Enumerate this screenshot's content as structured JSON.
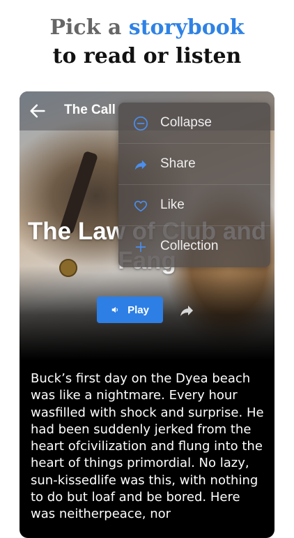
{
  "promo": {
    "line1_prefix": "Pick a",
    "line1_accent": "storybook",
    "line2": "to read or listen"
  },
  "colors": {
    "accent": "#2e82e5",
    "play_button": "#2d7fe6",
    "menu_icon": "#4a8ff0"
  },
  "reader": {
    "screen_title": "The Call",
    "book_title": "The Law of Club and Fang",
    "play_label": "Play",
    "body": "Buck’s first day on the Dyea beach was like a nightmare. Every hour wasfilled with shock and surprise. He had been suddenly jerked from the heart ofcivilization and flung into the heart of things primordial. No lazy, sun-kissedlife was this, with nothing to do but loaf and be bored. Here was neitherpeace, nor"
  },
  "menu": {
    "items": [
      {
        "label": "Collapse",
        "icon": "collapse-icon"
      },
      {
        "label": "Share",
        "icon": "share-icon"
      },
      {
        "label": "Like",
        "icon": "heart-icon"
      },
      {
        "label": "Collection",
        "icon": "plus-icon"
      }
    ]
  }
}
